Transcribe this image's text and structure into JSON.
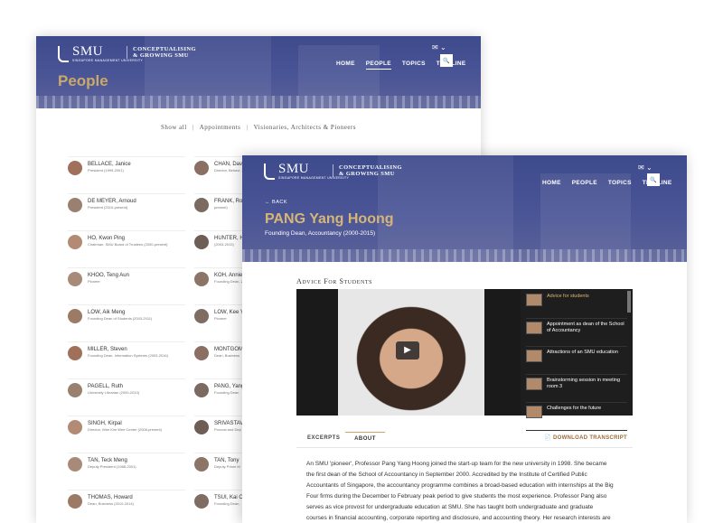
{
  "brand": {
    "logo_text": "SMU",
    "logo_subtext": "SINGAPORE MANAGEMENT UNIVERSITY",
    "tagline_line1": "CONCEPTUALISING",
    "tagline_line2": "& GROWING SMU"
  },
  "nav": {
    "home": "HOME",
    "people": "PEOPLE",
    "topics": "TOPICS",
    "timeline": "TIMELINE"
  },
  "icons": {
    "mail": "✉",
    "chevron": "⌄",
    "search": "🔍"
  },
  "people_page": {
    "heading": "People",
    "filters": {
      "show_all": "Show all",
      "sep": "|",
      "appointments": "Appointments",
      "visionaries": "Visionaries, Architects & Pioneers"
    },
    "people": [
      {
        "name": "BELLACE, Janice",
        "role": "President (1999-2001)"
      },
      {
        "name": "CHAN, David",
        "role": "Director, Behavi... present)"
      },
      {
        "name": "DE MEYER, Arnoud",
        "role": "President (2010-present)"
      },
      {
        "name": "FRANK, Rona",
        "role": "present)"
      },
      {
        "name": "HO, Kwon Ping",
        "role": "Chairman, SMU Board of Trustees (2000-present)"
      },
      {
        "name": "HUNTER, Hov",
        "role": "(2003-2013)"
      },
      {
        "name": "KHOO, Teng Aun",
        "role": "Pioneer"
      },
      {
        "name": "KOH, Annie",
        "role": "Founding Dean, 2007)"
      },
      {
        "name": "LOW, Aik Meng",
        "role": "Founding Dean of Students (2003-2011)"
      },
      {
        "name": "LOW, Kee Yan",
        "role": "Pioneer"
      },
      {
        "name": "MILLER, Steven",
        "role": "Founding Dean, Information Systems (2003-2016)"
      },
      {
        "name": "MONTGOMER",
        "role": "Dean, Business"
      },
      {
        "name": "PAGELL, Ruth",
        "role": "University Librarian (2000-2010)"
      },
      {
        "name": "PANG, Yang H",
        "role": "Founding Dean"
      },
      {
        "name": "SINGH, Kirpal",
        "role": "Director, Wee Kim Wee Center (2008-present)"
      },
      {
        "name": "SRIVASTAVA,",
        "role": "Provost and Dep"
      },
      {
        "name": "TAN, Teck Meng",
        "role": "Deputy President (1988-2001)"
      },
      {
        "name": "TAN, Tony",
        "role": "Deputy Prime M"
      },
      {
        "name": "THOMAS, Howard",
        "role": "Dean, Business (2010-2014)"
      },
      {
        "name": "TSUI, Kai Ch",
        "role": "Founding Dean,"
      }
    ]
  },
  "profile": {
    "back": "BACK",
    "name": "PANG Yang Hoong",
    "title": "Founding Dean, Accountancy (2000-2015)",
    "section_title": "Advice for students",
    "playlist": [
      "Advice for students",
      "Appointment as dean of the School of Accountancy",
      "Attractions of an SMU education",
      "Brainstorming session in meeting room 3",
      "Challenges for the future"
    ],
    "tabs": {
      "excerpts": "EXCERPTS",
      "about": "ABOUT"
    },
    "download": "DOWNLOAD TRANSCRIPT",
    "about_text": "An SMU 'pioneer', Professor Pang Yang Hoong joined the start-up team for the new university in 1998. She became the first dean of the School of Accountancy in September 2000. Accredited by the Institute of Certified Public Accountants of Singapore, the accountancy programme combines a broad-based education with internships at the Big Four firms during the December to February peak period to give students the most experience. Professor Pang also serves as vice provost for undergraduate education at SMU. She has taught both undergraduate and graduate courses in financial accounting, corporate reporting and disclosure, and accounting theory. Her research interests are"
  },
  "colors": {
    "banner": "#3d4a8c",
    "gold": "#c9a86a",
    "heading_gold": "#d7b577"
  }
}
